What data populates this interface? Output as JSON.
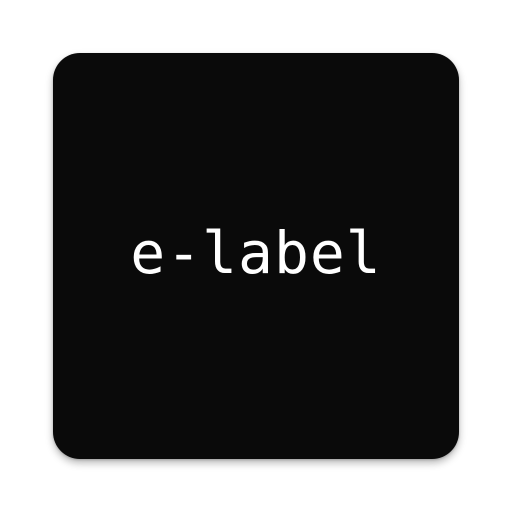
{
  "app_icon": {
    "label": "e-label",
    "background_color": "#0a0a0a",
    "text_color": "#ffffff"
  }
}
